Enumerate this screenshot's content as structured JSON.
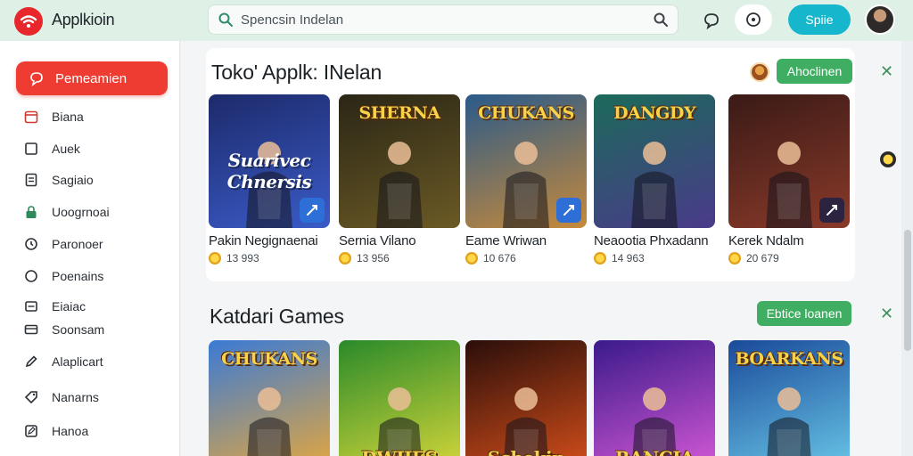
{
  "app": {
    "title": "Applkioin"
  },
  "search": {
    "placeholder": "Spencsin Indelan"
  },
  "header": {
    "login_label": "Spiie"
  },
  "sidebar": {
    "active": {
      "label": "Pemeamien"
    },
    "items": [
      {
        "label": "Biana",
        "icon": "calendar-icon"
      },
      {
        "label": "Auek",
        "icon": "square-icon"
      },
      {
        "label": "Sagiaio",
        "icon": "document-icon"
      },
      {
        "label": "Uoogrnoai",
        "icon": "lock-icon"
      },
      {
        "label": "Paronoer",
        "icon": "refresh-icon"
      },
      {
        "label": "Poenains",
        "icon": "circle-icon"
      },
      {
        "label": "Eiaiac",
        "icon": "message-icon"
      },
      {
        "label": "Soonsam",
        "icon": "card-icon"
      },
      {
        "label": "Alaplicart",
        "icon": "pen-icon"
      },
      {
        "label": "Nanarns",
        "icon": "tag-icon"
      },
      {
        "label": "Hanoa",
        "icon": "edit-icon"
      }
    ]
  },
  "sections": [
    {
      "title": "Toko' Applk: INelan",
      "action_label": "Ahoclinen",
      "games": [
        {
          "title": "Pakin Negignaenai",
          "rating": "13 993",
          "art": "Suarivec Chnersis",
          "colors": [
            "#1d2a6b",
            "#3a5bc7"
          ]
        },
        {
          "title": "Sernia Vilano",
          "rating": "13 956",
          "art": "SHERNA",
          "colors": [
            "#2a2616",
            "#6b5a25"
          ]
        },
        {
          "title": "Eame Wriwan",
          "rating": "10 676",
          "art": "CHUKANS",
          "colors": [
            "#2a5a8a",
            "#c78a3a"
          ]
        },
        {
          "title": "Neaootia Phxadann",
          "rating": "14 963",
          "art": "DANGDY",
          "colors": [
            "#1c6a5a",
            "#4a3a8a"
          ]
        },
        {
          "title": "Kerek Ndalm",
          "rating": "20 679",
          "art": "",
          "colors": [
            "#3a1a16",
            "#8a3a2a"
          ]
        }
      ]
    },
    {
      "title": "Katdari Games",
      "action_label": "Ebtice loanen",
      "games": [
        {
          "title": "",
          "rating": "",
          "art": "CHUKANS",
          "colors": [
            "#3a7ad6",
            "#e8a83a"
          ]
        },
        {
          "title": "",
          "rating": "",
          "art": "DWIIES",
          "colors": [
            "#2a8a2a",
            "#d8d83a"
          ]
        },
        {
          "title": "",
          "rating": "",
          "art": "Schekin",
          "colors": [
            "#2a0e0a",
            "#d8501a"
          ]
        },
        {
          "title": "",
          "rating": "",
          "art": "RANCIA",
          "colors": [
            "#3a1a8a",
            "#d85ad8"
          ]
        },
        {
          "title": "",
          "rating": "",
          "art": "BOARKANS",
          "colors": [
            "#1a4a9a",
            "#6ac8e8"
          ]
        }
      ]
    }
  ],
  "accent": "#ee3c32",
  "brand_green": "#3fae62",
  "login_color": "#16b6cc"
}
